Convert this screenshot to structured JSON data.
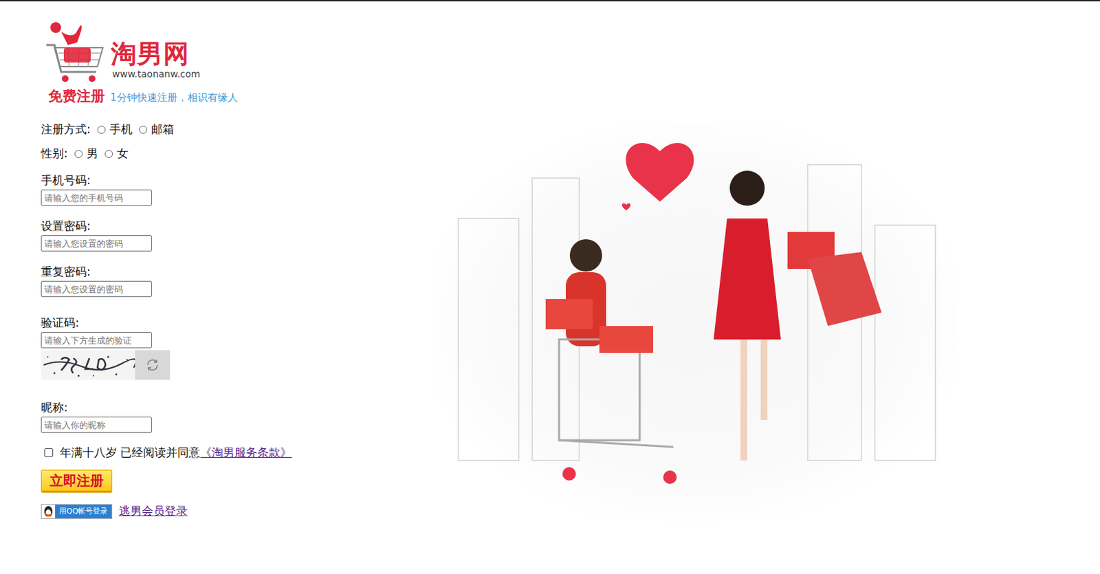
{
  "logo": {
    "name": "淘男网",
    "url": "www.taonanw.com",
    "tagline_title": "免费注册",
    "tagline": "1分钟快速注册，相识有缘人"
  },
  "register_method": {
    "label": "注册方式:",
    "options": [
      {
        "label": "手机",
        "selected": false
      },
      {
        "label": "邮箱",
        "selected": false
      }
    ]
  },
  "gender": {
    "label": "性别:",
    "options": [
      {
        "label": "男",
        "selected": false
      },
      {
        "label": "女",
        "selected": false
      }
    ]
  },
  "fields": [
    {
      "label": "手机号码:",
      "placeholder": "请输入您的手机号码"
    },
    {
      "label": "设置密码:",
      "placeholder": "请输入您设置的密码"
    },
    {
      "label": "重复密码:",
      "placeholder": "请输入您设置的密码"
    }
  ],
  "captcha": {
    "label": "验证码:",
    "placeholder": "请输入下方生成的验证"
  },
  "nickname": {
    "label": "昵称:",
    "placeholder": "请输入你的昵称"
  },
  "agreement": {
    "checked": false,
    "text": "年满十八岁 已经阅读并同意",
    "link": "《淘男服务条款》"
  },
  "submit": "立即注册",
  "qq_login": "用QQ帐号登录",
  "member_login": "逃男会员登录"
}
